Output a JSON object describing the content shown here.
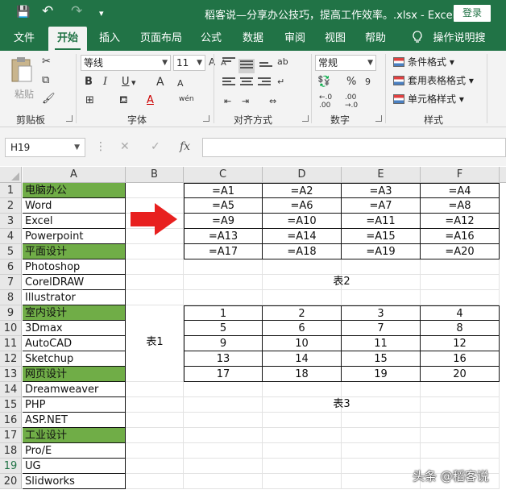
{
  "titlebar": {
    "title": "稻客说—分享办公技巧，提高工作效率。.xlsx  -  Excel",
    "login": "登录",
    "save_icon": "💾",
    "undo_icon": "↶",
    "redo_icon": "↷",
    "customize_icon": "▾"
  },
  "tabs": [
    "文件",
    "开始",
    "插入",
    "页面布局",
    "公式",
    "数据",
    "审阅",
    "视图",
    "帮助"
  ],
  "active_tab": "开始",
  "tell_me": "操作说明搜索",
  "ribbon": {
    "clipboard": {
      "paste": "粘贴",
      "label": "剪贴板"
    },
    "font": {
      "name": "等线",
      "size": "11",
      "label": "字体",
      "bold": "B",
      "italic": "I",
      "underline": "U",
      "grow": "A",
      "shrink": "A",
      "phonetic": "wén",
      "color_a": "A"
    },
    "alignment": {
      "label": "对齐方式"
    },
    "number": {
      "format": "常规",
      "label": "数字",
      "percent": "%",
      "comma": "9",
      "inc": "←.0\n.00",
      "dec": ".00\n→.0"
    },
    "styles": {
      "conditional": "条件格式",
      "table": "套用表格格式",
      "cell": "单元格样式",
      "label": "样式"
    }
  },
  "formula_bar": {
    "name_box": "H19",
    "cancel": "✕",
    "enter": "✓",
    "fx": "fx",
    "formula": ""
  },
  "grid": {
    "columns": [
      "A",
      "B",
      "C",
      "D",
      "E",
      "F"
    ],
    "rows": [
      "1",
      "2",
      "3",
      "4",
      "5",
      "6",
      "7",
      "8",
      "9",
      "10",
      "11",
      "12",
      "13",
      "14",
      "15",
      "16",
      "17",
      "18",
      "19",
      "20"
    ],
    "col_a": [
      "电脑办公",
      "Word",
      "Excel",
      "Powerpoint",
      "平面设计",
      "Photoshop",
      "CorelDRAW",
      "Illustrator",
      "室内设计",
      "3Dmax",
      "AutoCAD",
      "Sketchup",
      "网页设计",
      "Dreamweaver",
      "PHP",
      "ASP.NET",
      "工业设计",
      "Pro/E",
      "UG",
      "Slidworks"
    ],
    "col_a_green_rows": [
      1,
      5,
      9,
      13,
      17
    ],
    "table1_label": "表1",
    "table2": [
      [
        "=A1",
        "=A2",
        "=A3",
        "=A4"
      ],
      [
        "=A5",
        "=A6",
        "=A7",
        "=A8"
      ],
      [
        "=A9",
        "=A10",
        "=A11",
        "=A12"
      ],
      [
        "=A13",
        "=A14",
        "=A15",
        "=A16"
      ],
      [
        "=A17",
        "=A18",
        "=A19",
        "=A20"
      ]
    ],
    "table2_label": "表2",
    "table3": [
      [
        "1",
        "2",
        "3",
        "4"
      ],
      [
        "5",
        "6",
        "7",
        "8"
      ],
      [
        "9",
        "10",
        "11",
        "12"
      ],
      [
        "13",
        "14",
        "15",
        "16"
      ],
      [
        "17",
        "18",
        "19",
        "20"
      ]
    ],
    "table3_label": "表3"
  },
  "watermark": "头条 @稻客说",
  "colors": {
    "excel_green": "#217346",
    "header_fill": "#70ad47",
    "arrow": "#e8201f"
  }
}
